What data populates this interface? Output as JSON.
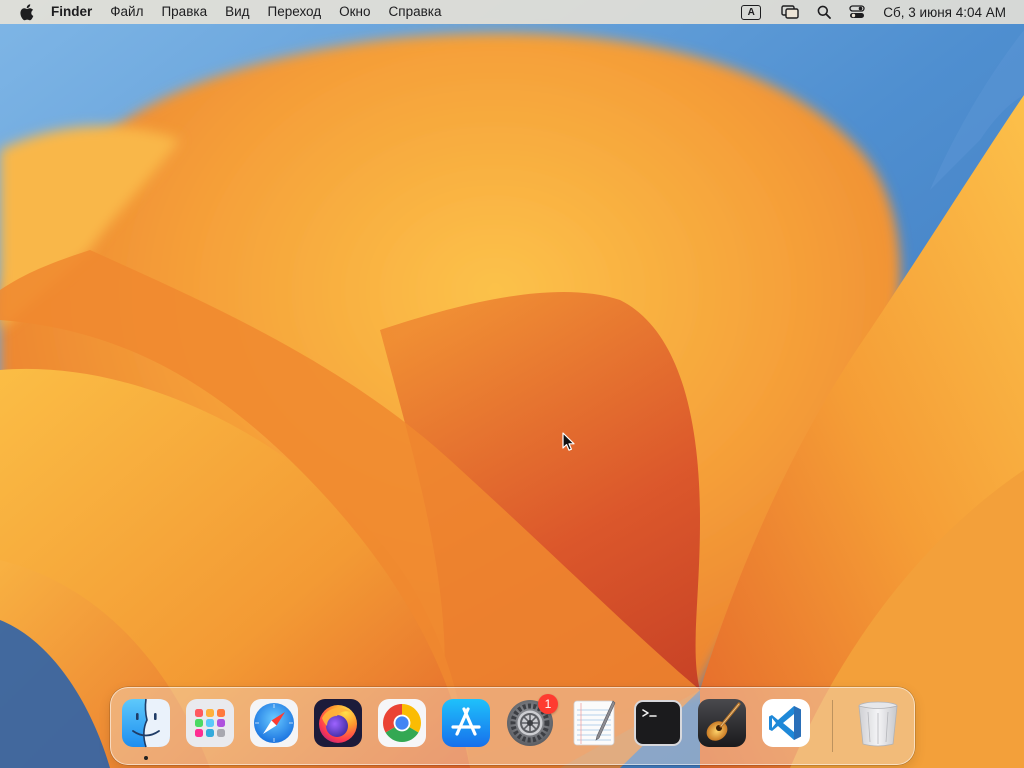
{
  "menubar": {
    "app_name": "Finder",
    "menus": [
      "Файл",
      "Правка",
      "Вид",
      "Переход",
      "Окно",
      "Справка"
    ],
    "input_source": "A",
    "clock": "Сб, 3 июня  4:04 AM",
    "icons": [
      "apple-icon",
      "input-source-icon",
      "screen-mirroring-icon",
      "search-icon",
      "control-center-icon"
    ]
  },
  "dock": {
    "items": [
      {
        "name": "Finder",
        "icon": "finder-icon",
        "running": true
      },
      {
        "name": "Launchpad",
        "icon": "launchpad-icon"
      },
      {
        "name": "Safari",
        "icon": "safari-icon"
      },
      {
        "name": "Firefox",
        "icon": "firefox-icon"
      },
      {
        "name": "Google Chrome",
        "icon": "chrome-icon"
      },
      {
        "name": "App Store",
        "icon": "app-store-icon"
      },
      {
        "name": "System Settings",
        "icon": "settings-icon",
        "badge": "1"
      },
      {
        "name": "TextEdit",
        "icon": "textedit-icon"
      },
      {
        "name": "Terminal",
        "icon": "terminal-icon"
      },
      {
        "name": "GarageBand",
        "icon": "garageband-icon"
      },
      {
        "name": "Visual Studio Code",
        "icon": "vscode-icon"
      },
      {
        "name": "Trash",
        "icon": "trash-icon"
      }
    ]
  },
  "colors": {
    "wallpaper_blue": "#4a86c8",
    "wallpaper_orange": "#f29a2e",
    "wallpaper_red": "#d2452a",
    "badge_red": "#ff3b30"
  }
}
